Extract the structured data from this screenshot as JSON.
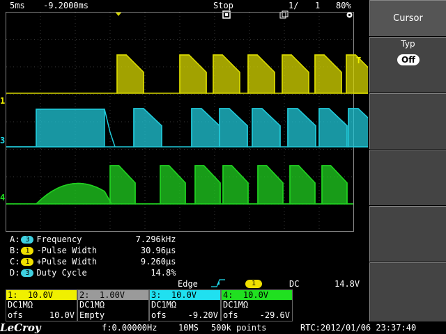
{
  "topbar": {
    "timebase": "5ms",
    "delay": "-9.2000ms",
    "run_state": "Stop",
    "page": "1/",
    "page_total": "1",
    "battery": "80%"
  },
  "sidebar": {
    "title": "Cursor",
    "typ_label": "Typ",
    "typ_value": "Off"
  },
  "channel_markers": {
    "ch1": "1",
    "ch3": "3",
    "ch4": "4",
    "trigger": "T"
  },
  "measurements": [
    {
      "letter": "A:",
      "src": "3",
      "name": "Frequency",
      "value": "7.296kHz",
      "color": "#3fd0e0"
    },
    {
      "letter": "B:",
      "src": "1",
      "name": "-Pulse Width",
      "value": "30.96µs",
      "color": "#f0e000"
    },
    {
      "letter": "C:",
      "src": "1",
      "name": "+Pulse Width",
      "value": "9.260µs",
      "color": "#f0e000"
    },
    {
      "letter": "D:",
      "src": "3",
      "name": "Duty Cycle",
      "value": "14.8%",
      "color": "#3fd0e0"
    }
  ],
  "trigger": {
    "label": "Edge",
    "source": "1",
    "coupling": "DC",
    "level": "14.8V"
  },
  "channels": [
    {
      "head": "1:  10.0V",
      "line1": "DC1MΩ",
      "line2a": "ofs",
      "line2b": "10.0V",
      "color": "#f0f000"
    },
    {
      "head": "2:  1.00V",
      "line1": "DC1MΩ",
      "line2a": "Empty",
      "line2b": "",
      "color": "#9a9a9a"
    },
    {
      "head": "3:  10.0V",
      "line1": "DC1MΩ",
      "line2a": "ofs",
      "line2b": "-9.20V",
      "color": "#20e0f0"
    },
    {
      "head": "4:  10.0V",
      "line1": "DC1MΩ",
      "line2a": "ofs",
      "line2b": "-29.6V",
      "color": "#20e020"
    }
  ],
  "bottombar": {
    "brand": "LeCroy",
    "freq": "f:0.00000Hz",
    "rate": "10MS",
    "points": "500k points",
    "rtc": "RTC:2012/01/06 23:37:40"
  },
  "colors": {
    "ch1": "#d8d800",
    "ch3": "#20c8d8",
    "ch4": "#20d020"
  }
}
